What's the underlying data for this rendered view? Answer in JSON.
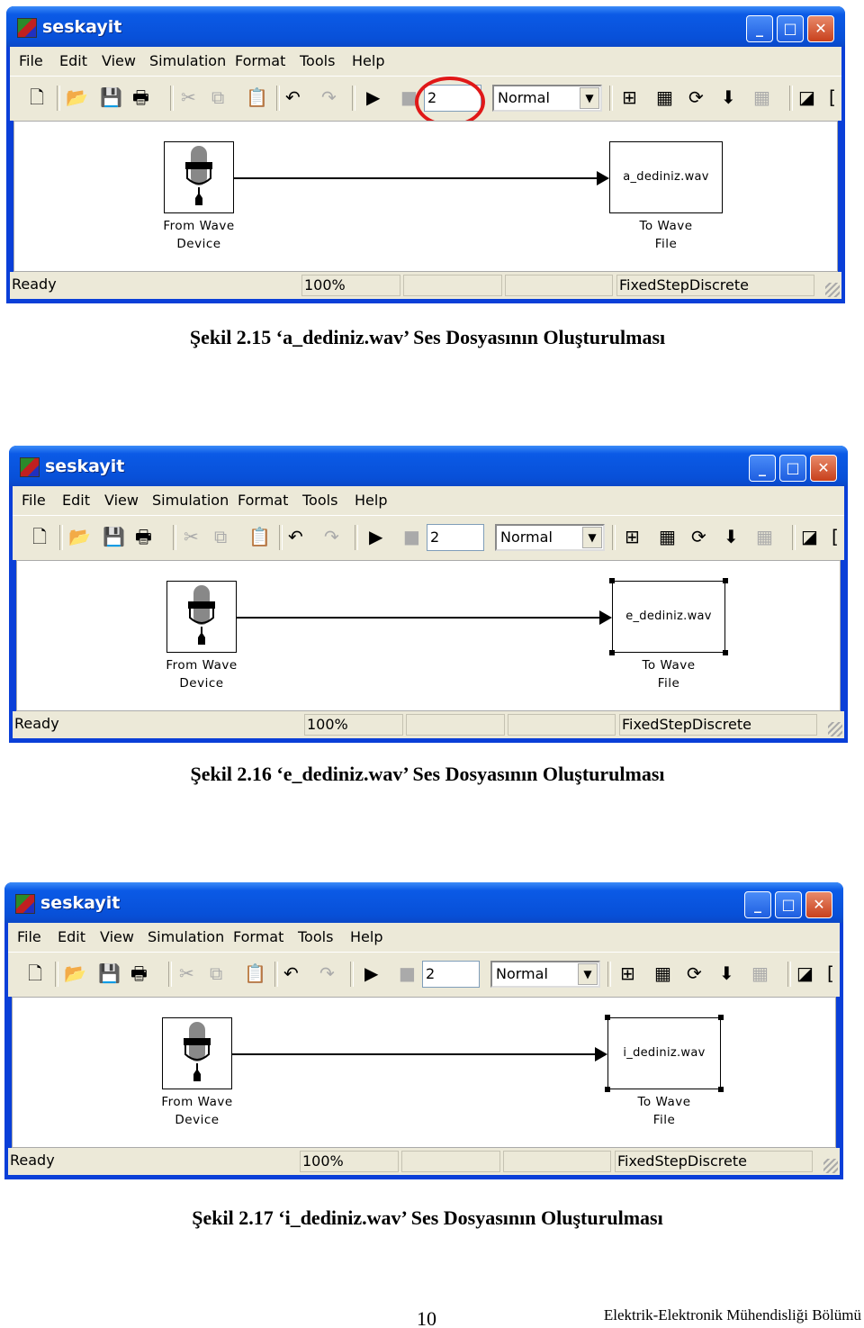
{
  "windows": [
    {
      "title": "seskayit",
      "menu": [
        "File",
        "Edit",
        "View",
        "Simulation",
        "Format",
        "Tools",
        "Help"
      ],
      "stop_time": "2",
      "sim_mode": "Normal",
      "source_block": {
        "line1": "From Wave",
        "line2": "Device"
      },
      "sink_block": {
        "filename": "a_dediniz.wav",
        "line1": "To Wave",
        "line2": "File"
      },
      "sink_selected": false,
      "stop_time_highlighted": true,
      "status": {
        "state": "Ready",
        "zoom": "100%",
        "solver": "FixedStepDiscrete"
      }
    },
    {
      "title": "seskayit",
      "menu": [
        "File",
        "Edit",
        "View",
        "Simulation",
        "Format",
        "Tools",
        "Help"
      ],
      "stop_time": "2",
      "sim_mode": "Normal",
      "source_block": {
        "line1": "From Wave",
        "line2": "Device"
      },
      "sink_block": {
        "filename": "e_dediniz.wav",
        "line1": "To Wave",
        "line2": "File"
      },
      "sink_selected": true,
      "stop_time_highlighted": false,
      "status": {
        "state": "Ready",
        "zoom": "100%",
        "solver": "FixedStepDiscrete"
      }
    },
    {
      "title": "seskayit",
      "menu": [
        "File",
        "Edit",
        "View",
        "Simulation",
        "Format",
        "Tools",
        "Help"
      ],
      "stop_time": "2",
      "sim_mode": "Normal",
      "source_block": {
        "line1": "From Wave",
        "line2": "Device"
      },
      "sink_block": {
        "filename": "i_dediniz.wav",
        "line1": "To Wave",
        "line2": "File"
      },
      "sink_selected": true,
      "stop_time_highlighted": false,
      "status": {
        "state": "Ready",
        "zoom": "100%",
        "solver": "FixedStepDiscrete"
      }
    }
  ],
  "captions": [
    "Şekil 2.15 ‘a_dediniz.wav’ Ses Dosyasının Oluşturulması",
    "Şekil 2.16 ‘e_dediniz.wav’ Ses Dosyasının Oluşturulması",
    "Şekil 2.17 ‘i_dediniz.wav’ Ses Dosyasının Oluşturulması"
  ],
  "footer": {
    "page_number": "10",
    "department": "Elektrik-Elektronik Mühendisliği Bölümü"
  },
  "colors": {
    "titlebar": "#0a50d8",
    "highlight_circle": "#e01818",
    "chrome": "#ece9d8"
  }
}
